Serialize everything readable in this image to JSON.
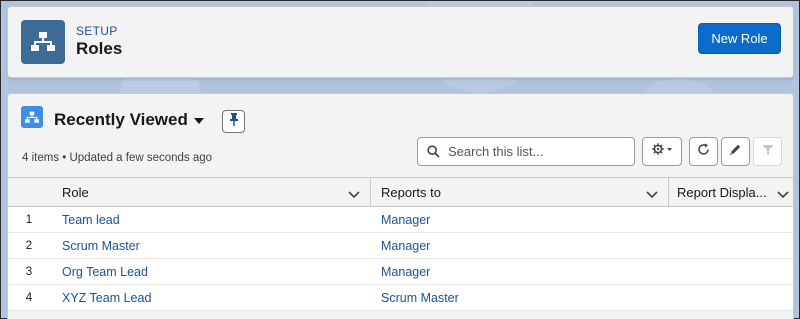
{
  "header": {
    "eyebrow": "SETUP",
    "title": "Roles",
    "new_button": "New Role",
    "icon": "hierarchy-icon"
  },
  "list": {
    "title": "Recently Viewed",
    "meta": "4 items • Updated a few seconds ago",
    "search": {
      "placeholder": "Search this list...",
      "value": ""
    },
    "icons": [
      "hierarchy-icon",
      "chevron-down-icon",
      "pin-icon",
      "search-icon",
      "gear-icon",
      "refresh-icon",
      "pencil-icon",
      "filter-icon"
    ]
  },
  "table": {
    "columns": [
      "Role",
      "Reports to",
      "Report Displa..."
    ],
    "rows": [
      {
        "num": "1",
        "role": "Team lead",
        "reports_to": "Manager",
        "display": ""
      },
      {
        "num": "2",
        "role": "Scrum Master",
        "reports_to": "Manager",
        "display": ""
      },
      {
        "num": "3",
        "role": "Org Team Lead",
        "reports_to": "Manager",
        "display": ""
      },
      {
        "num": "4",
        "role": "XYZ Team Lead",
        "reports_to": "Scrum Master",
        "display": ""
      }
    ]
  },
  "colors": {
    "brand": "#0b6bcb",
    "icon_bg": "#3d6b96",
    "link": "#1b5297",
    "background": "#b0c4df"
  }
}
